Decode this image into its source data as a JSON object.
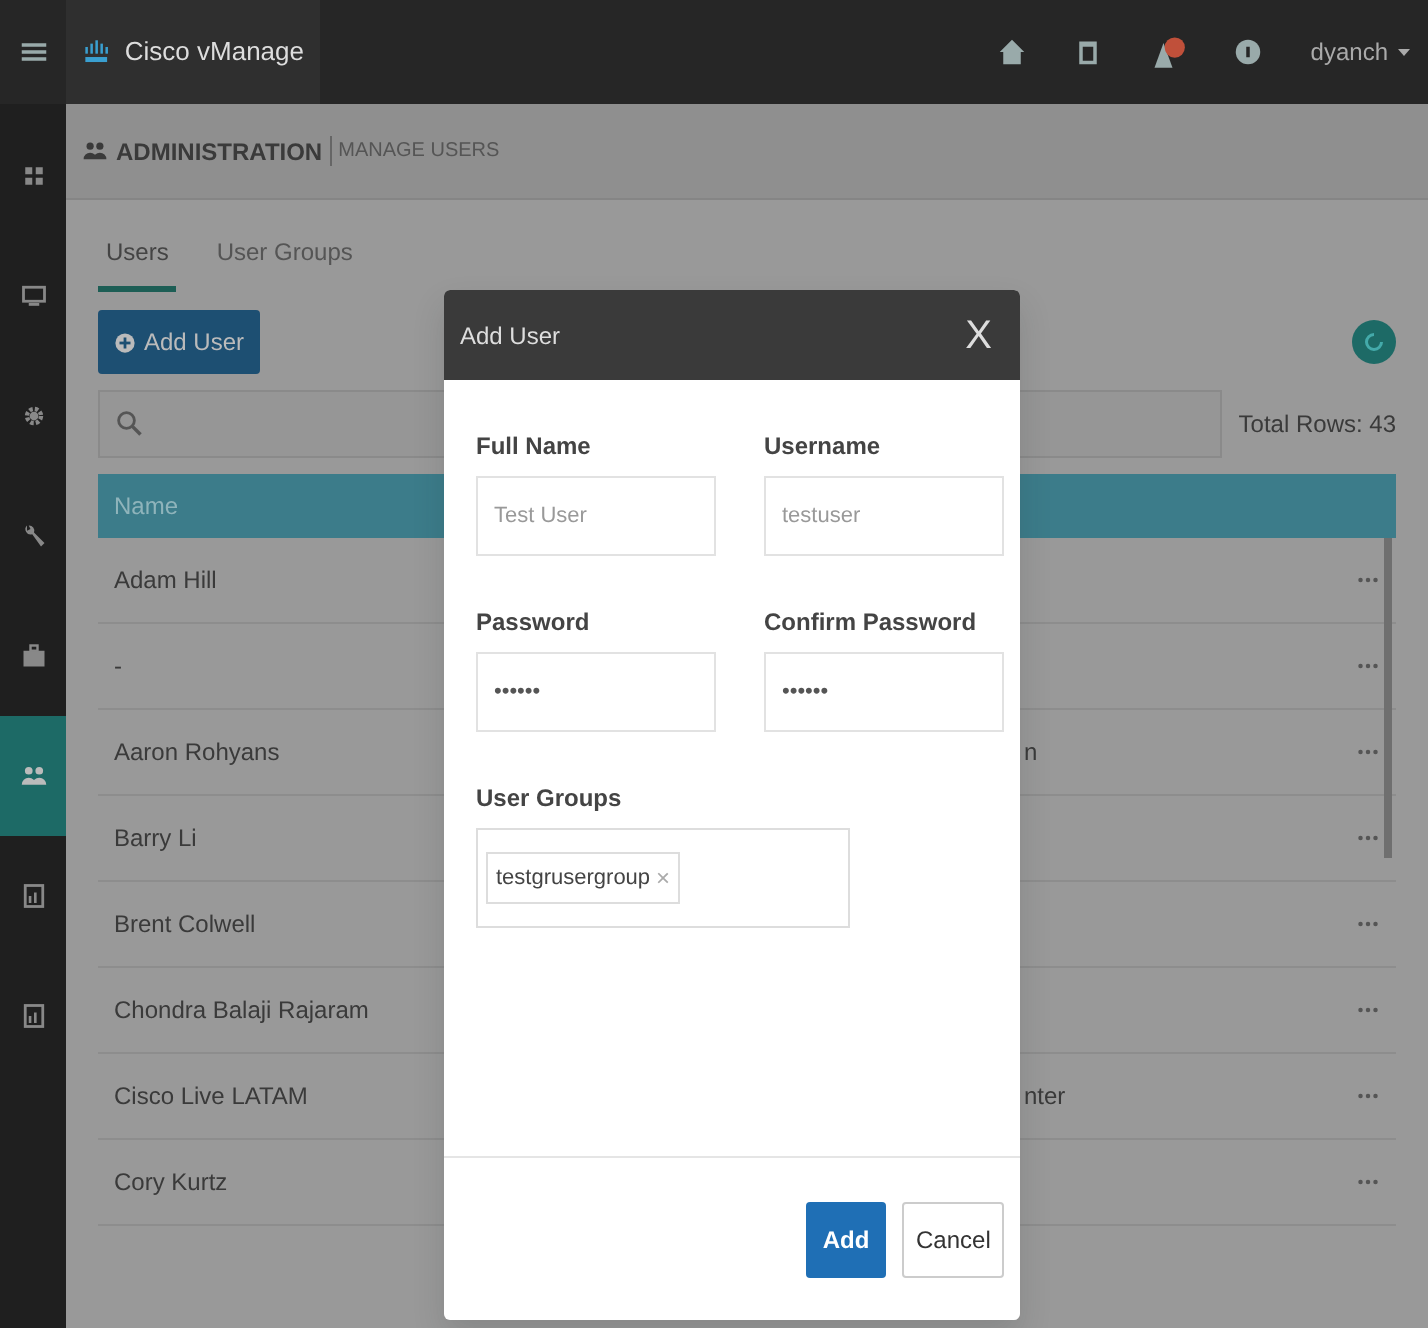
{
  "app": {
    "title": "Cisco vManage",
    "user": "dyanch"
  },
  "rail": [
    {
      "kind": "grid",
      "selected": false
    },
    {
      "kind": "monitor",
      "selected": false
    },
    {
      "kind": "gear",
      "selected": false
    },
    {
      "kind": "wrench",
      "selected": false
    },
    {
      "kind": "briefcase",
      "selected": false
    },
    {
      "kind": "users",
      "selected": true
    },
    {
      "kind": "report",
      "selected": false
    },
    {
      "kind": "report",
      "selected": false
    }
  ],
  "breadcrumb": {
    "section": "ADMINISTRATION",
    "page": "MANAGE USERS"
  },
  "tabs": [
    {
      "label": "Users",
      "selected": true
    },
    {
      "label": "User Groups",
      "selected": false
    }
  ],
  "add_button": "Add User",
  "total_rows": "Total Rows: 43",
  "table": {
    "columns": [
      "Name"
    ],
    "rows": [
      {
        "name": "Adam Hill"
      },
      {
        "name": "-"
      },
      {
        "name": "Aaron Rohyans",
        "column_2": "n"
      },
      {
        "name": "Barry Li"
      },
      {
        "name": "Brent Colwell"
      },
      {
        "name": "Chondra Balaji Rajaram"
      },
      {
        "name": "Cisco Live LATAM",
        "column_2": "nter"
      },
      {
        "name": "Cory Kurtz"
      }
    ]
  },
  "modal": {
    "title": "Add User",
    "close": "X",
    "fields": [
      {
        "label": "Full Name",
        "placeholder": "Test User"
      },
      {
        "label": "Username",
        "placeholder": "testuser"
      },
      {
        "label": "Password",
        "value": "••••••"
      },
      {
        "label": "Confirm Password",
        "value": "••••••"
      }
    ],
    "groups": {
      "label": "User Groups",
      "tags": [
        {
          "label": "testgrusergroup",
          "remove": "×"
        }
      ]
    },
    "buttons": [
      {
        "label": "Add",
        "kind": "primary"
      },
      {
        "label": "Cancel",
        "kind": "secondary"
      }
    ]
  }
}
